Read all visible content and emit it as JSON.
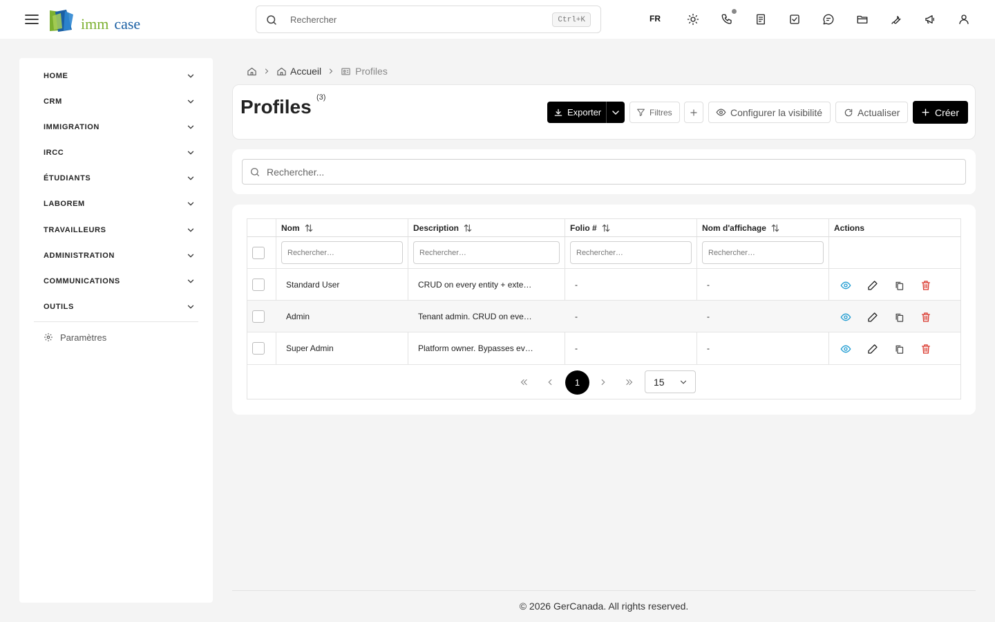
{
  "header": {
    "logo_part1": "imm",
    "logo_part2": "case",
    "search_placeholder": "Rechercher",
    "search_shortcut": "Ctrl+K",
    "language": "FR",
    "icons": [
      "theme-sun-icon",
      "phone-icon",
      "notes-icon",
      "tasks-icon",
      "chat-icon",
      "folder-icon",
      "tools-icon",
      "announcement-icon",
      "user-icon"
    ]
  },
  "sidebar": {
    "items": [
      {
        "label": "HOME"
      },
      {
        "label": "CRM"
      },
      {
        "label": "IMMIGRATION"
      },
      {
        "label": "IRCC"
      },
      {
        "label": "ÉTUDIANTS"
      },
      {
        "label": "LABOREM"
      },
      {
        "label": "TRAVAILLEURS"
      },
      {
        "label": "ADMINISTRATION"
      },
      {
        "label": "COMMUNICATIONS"
      },
      {
        "label": "OUTILS"
      }
    ],
    "settings_label": "Paramètres"
  },
  "breadcrumb": {
    "home_label": "Accueil",
    "current_label": "Profiles"
  },
  "page": {
    "title": "Profiles",
    "count": "(3)",
    "buttons": {
      "export": "Exporter",
      "filters": "Filtres",
      "visibility": "Configurer la visibilité",
      "refresh": "Actualiser",
      "create": "Créer"
    }
  },
  "search": {
    "placeholder": "Rechercher..."
  },
  "table": {
    "columns": [
      "Nom",
      "Description",
      "Folio #",
      "Nom d'affichage",
      "Actions"
    ],
    "filter_placeholder": "Rechercher…",
    "rows": [
      {
        "nom": "Standard User",
        "description": "CRUD on every entity + exte…",
        "folio": "-",
        "affichage": "-"
      },
      {
        "nom": "Admin",
        "description": "Tenant admin. CRUD on eve…",
        "folio": "-",
        "affichage": "-"
      },
      {
        "nom": "Super Admin",
        "description": "Platform owner. Bypasses ev…",
        "folio": "-",
        "affichage": "-"
      }
    ],
    "action_colors": {
      "view": "#1d9bd1",
      "edit": "#222222",
      "copy": "#444444",
      "delete": "#d9362b"
    }
  },
  "pagination": {
    "current_page": "1",
    "page_size": "15"
  },
  "footer": {
    "text": "© 2026 GerCanada. All rights reserved."
  }
}
